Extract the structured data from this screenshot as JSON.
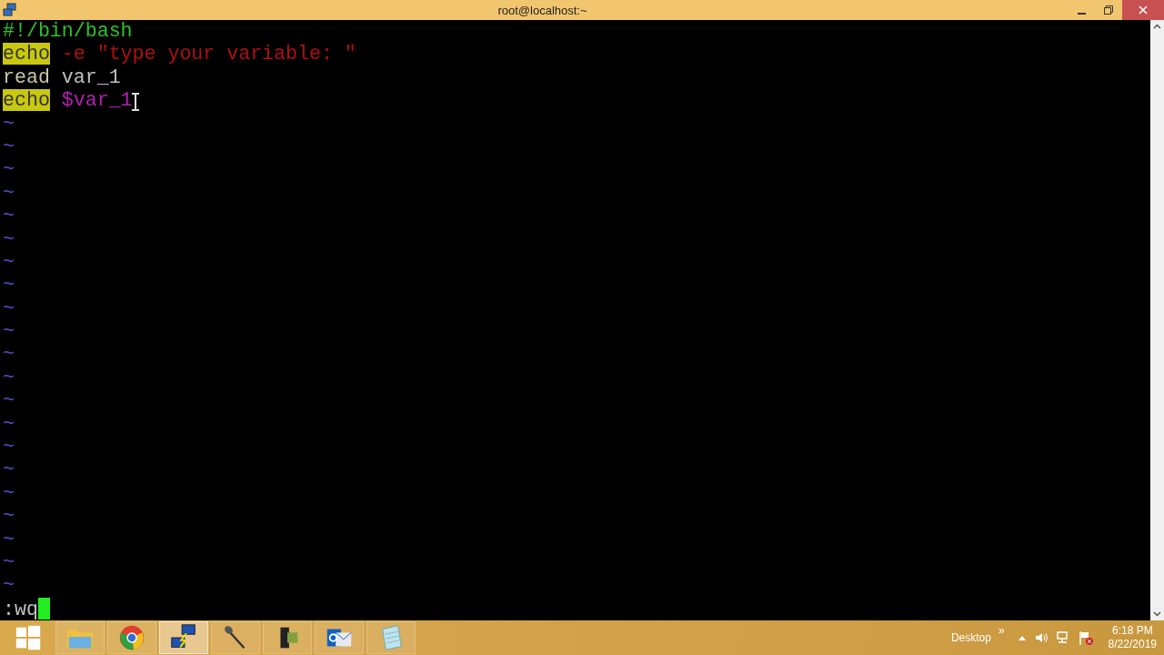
{
  "window": {
    "title": "root@localhost:~"
  },
  "editor": {
    "lines": [
      {
        "tokens": [
          {
            "kind": "comment",
            "text": "#!/bin/bash"
          }
        ]
      },
      {
        "tokens": [
          {
            "kind": "keyword",
            "text": "echo"
          },
          {
            "kind": "string",
            "text": "-e \"type your variable: \""
          }
        ]
      },
      {
        "tokens": [
          {
            "kind": "statement",
            "text": "read"
          },
          {
            "kind": "plain",
            "text": "var_1"
          }
        ]
      },
      {
        "tokens": [
          {
            "kind": "keyword",
            "text": "echo"
          },
          {
            "kind": "variable",
            "text": "$var_1"
          }
        ]
      }
    ],
    "empty_markers": [
      "~",
      "~",
      "~",
      "~",
      "~",
      "~",
      "~",
      "~",
      "~",
      "~",
      "~",
      "~",
      "~",
      "~",
      "~",
      "~",
      "~",
      "~",
      "~",
      "~",
      "~"
    ],
    "command_line": ":wq"
  },
  "taskbar": {
    "apps": [
      {
        "kind": "start",
        "selected": false
      },
      {
        "kind": "folder",
        "selected": false
      },
      {
        "kind": "browser",
        "selected": false
      },
      {
        "kind": "network",
        "selected": true
      },
      {
        "kind": "microphone",
        "selected": false
      },
      {
        "kind": "camera",
        "selected": false
      },
      {
        "kind": "mail",
        "selected": false
      },
      {
        "kind": "notepad",
        "selected": false
      }
    ],
    "desktop_label": "Desktop",
    "overflow": "»",
    "time": "6:18 PM",
    "date": "8/22/2019"
  }
}
